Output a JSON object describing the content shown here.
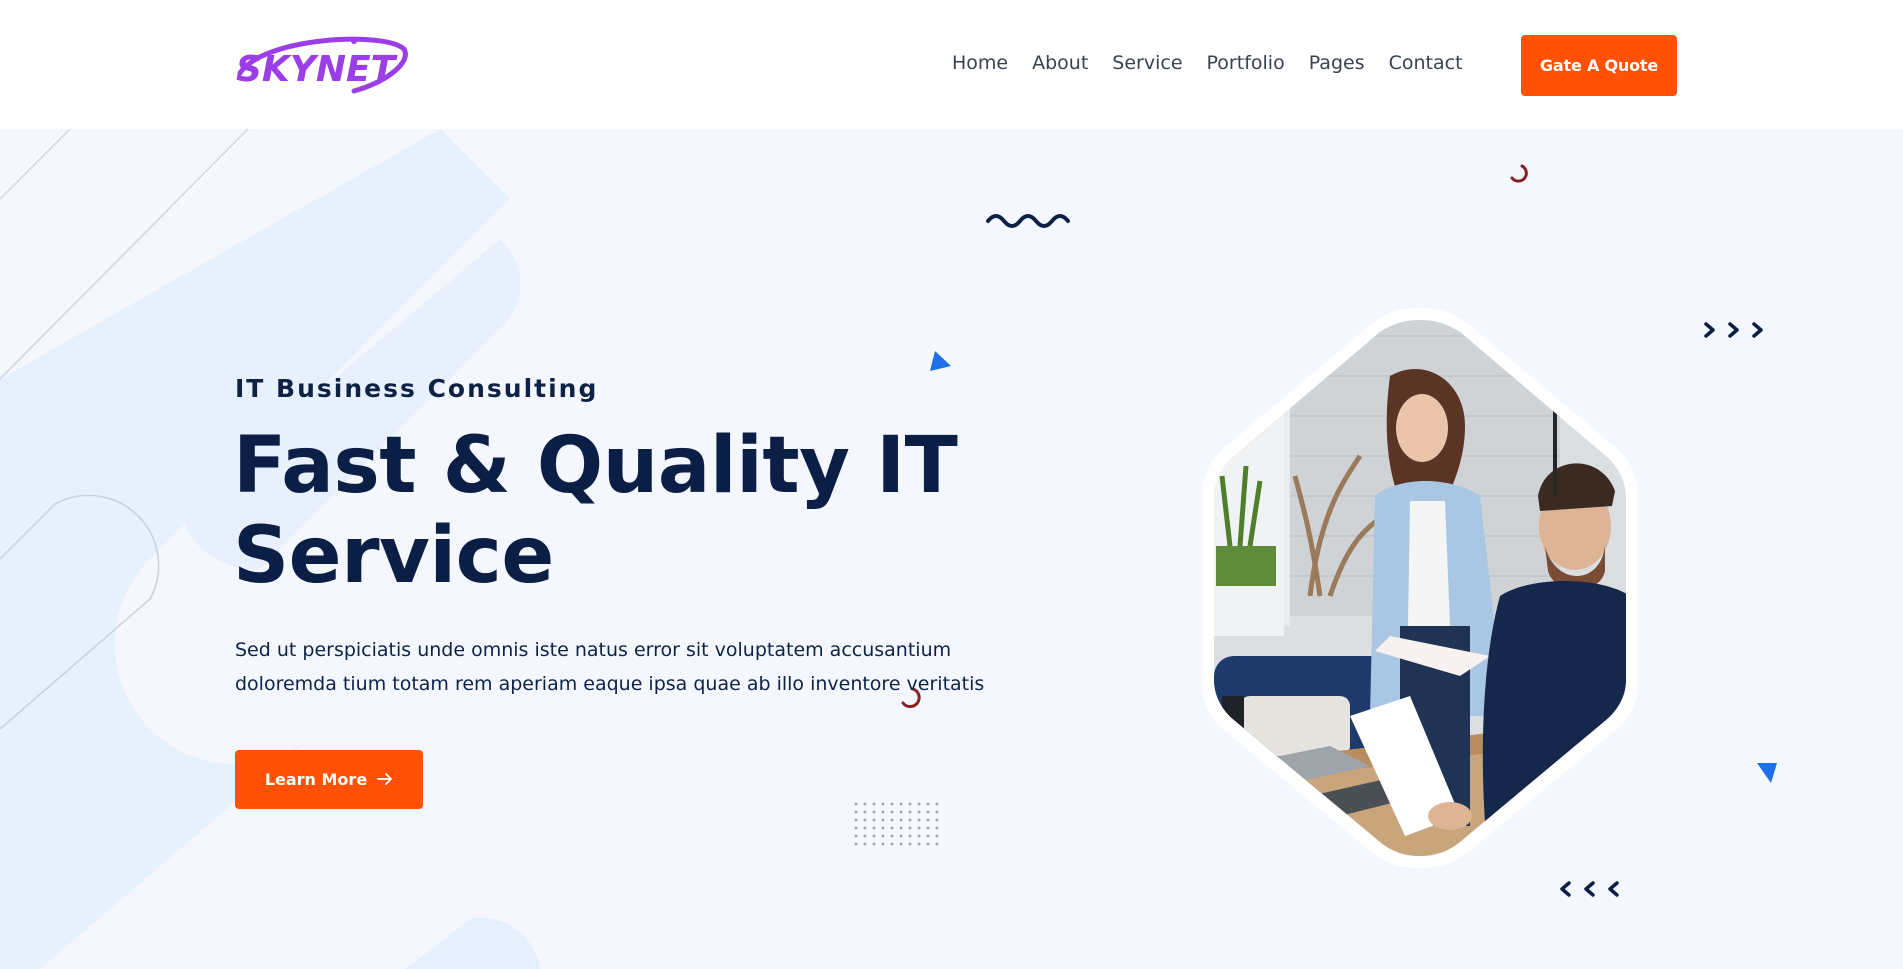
{
  "header": {
    "logo_text": "SKYNET",
    "nav": [
      "Home",
      "About",
      "Service",
      "Portfolio",
      "Pages",
      "Contact"
    ],
    "cta_label": "Gate A Quote"
  },
  "hero": {
    "subtitle": "IT Business Consulting",
    "headline_line1": "Fast & Quality IT",
    "headline_line2": "Service",
    "description_line1": "Sed ut perspiciatis unde omnis iste natus error sit voluptatem accusantium",
    "description_line2": "doloremda tium totam rem aperiam eaque ipsa quae ab illo inventore veritatis",
    "button_label": "Learn More",
    "button_icon": "arrow-right-icon",
    "image_alt": "two people reviewing documents at a desk"
  },
  "colors": {
    "accent": "#ff5207",
    "navy": "#0b1e45",
    "logo_purple": "#9b3ee8",
    "shape_blue": "#1e6fe8",
    "hero_bg": "#f4f8fe"
  }
}
